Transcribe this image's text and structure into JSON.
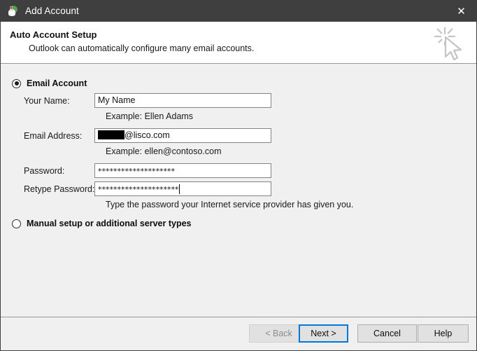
{
  "window": {
    "title": "Add Account",
    "icon": "outlook-account-icon",
    "close_label": "✕"
  },
  "header": {
    "title": "Auto Account Setup",
    "subtitle": "Outlook can automatically configure many email accounts.",
    "art_icon": "cursor-sparkle-icon"
  },
  "form": {
    "options": [
      {
        "id": "email-account",
        "label": "Email Account",
        "selected": true
      },
      {
        "id": "manual-setup",
        "label": "Manual setup or additional server types",
        "selected": false
      }
    ],
    "fields": [
      {
        "id": "your-name",
        "label": "Your Name:",
        "value": "My Name",
        "placeholder": "",
        "hint": "Example: Ellen Adams",
        "redacted": false,
        "masked": false
      },
      {
        "id": "email-address",
        "label": "Email Address:",
        "value": "@lisco.com",
        "placeholder": "",
        "hint": "Example: ellen@contoso.com",
        "redacted": true,
        "masked": false
      },
      {
        "id": "password",
        "label": "Password:",
        "value": "********************",
        "placeholder": "",
        "hint": "",
        "redacted": false,
        "masked": true
      },
      {
        "id": "retype-password",
        "label": "Retype Password:",
        "value": "*********************",
        "placeholder": "",
        "hint": "Type the password your Internet service provider has given you.",
        "redacted": false,
        "masked": true,
        "focused": true
      }
    ]
  },
  "footer": {
    "buttons": [
      {
        "id": "back",
        "label": "< Back",
        "state": "disabled"
      },
      {
        "id": "next",
        "label": "Next >",
        "state": "default"
      },
      {
        "id": "cancel",
        "label": "Cancel",
        "state": "normal"
      },
      {
        "id": "help",
        "label": "Help",
        "state": "normal"
      }
    ]
  },
  "colors": {
    "titlebar": "#3f3f3f",
    "body": "#f0f0f0",
    "accent": "#0078d7",
    "border": "#848484"
  }
}
